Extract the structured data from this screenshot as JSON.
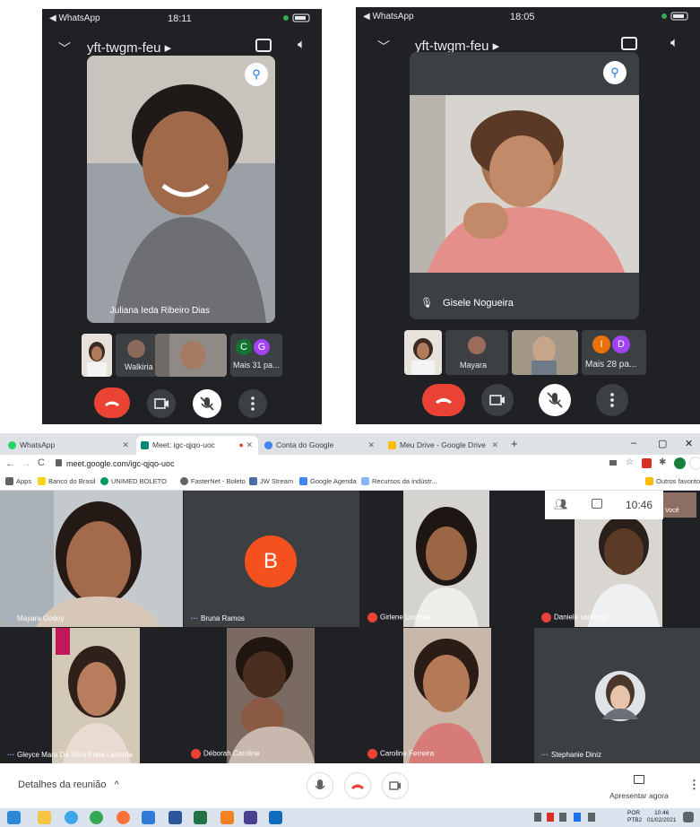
{
  "phone_left": {
    "status": {
      "carrier": "◀ WhatsApp",
      "time": "18:11"
    },
    "meeting_code": "yft-twgm-feu ▸",
    "main_tile_name": "Juliana Ieda Ribeiro Dias",
    "thumbs": [
      {
        "label": ""
      },
      {
        "label": "Walkiria"
      },
      {
        "label": ""
      },
      {
        "label": "Mais 31 pa..."
      }
    ],
    "more_avatars": [
      {
        "letter": "C",
        "color": "#137333"
      },
      {
        "letter": "G",
        "color": "#a142f4"
      }
    ]
  },
  "phone_right": {
    "status": {
      "carrier": "◀ WhatsApp",
      "time": "18:05"
    },
    "meeting_code": "yft-twgm-feu ▸",
    "main_tile_name": "Gisele Nogueira",
    "thumbs": [
      {
        "label": ""
      },
      {
        "label": "Mayara"
      },
      {
        "label": ""
      },
      {
        "label": "Mais 28 pa..."
      }
    ],
    "more_avatars": [
      {
        "letter": "I",
        "color": "#e8710a"
      },
      {
        "letter": "D",
        "color": "#a142f4"
      }
    ]
  },
  "browser": {
    "tabs": [
      {
        "label": "WhatsApp",
        "color": "#25d366",
        "active": false
      },
      {
        "label": "Meet: igc-qjqo-uoc",
        "color": "#00897b",
        "active": true
      },
      {
        "label": "Conta do Google",
        "color": "#4285f4",
        "active": false
      },
      {
        "label": "Meu Drive - Google Drive",
        "color": "#fbbc04",
        "active": false
      }
    ],
    "new_tab": "+",
    "window_controls": [
      "–",
      "▢",
      "✕"
    ],
    "url": "meet.google.com/igc-qjqo-uoc",
    "bookmarks": [
      {
        "label": "Apps",
        "color": "#5f6368"
      },
      {
        "label": "Banco do Brasil",
        "color": "#fcd116"
      },
      {
        "label": "UNIMED BOLETO",
        "color": "#00995d"
      },
      {
        "label": "FasterNet - Boleto",
        "color": "#5f6368"
      },
      {
        "label": "JW Stream",
        "color": "#4a6da7"
      },
      {
        "label": "Google Agenda",
        "color": "#4285f4"
      },
      {
        "label": "Recursos da indústr...",
        "color": "#8ab4f8"
      }
    ],
    "other_bookmarks": "Outros favoritos",
    "meet": {
      "time": "10:46",
      "self_label": "Você",
      "participants": [
        {
          "name": "Mayara Godoy",
          "muted": false
        },
        {
          "name": "Bruna Ramos",
          "muted": false,
          "avatar_letter": "B"
        },
        {
          "name": "Girlene Lustosa",
          "muted": true
        },
        {
          "name": "Daniele santiago",
          "muted": true
        },
        {
          "name": "Gleyce Mara Da Silva Faria Lacerda",
          "muted": false
        },
        {
          "name": "Déborah Caroline",
          "muted": true
        },
        {
          "name": "Caroline Ferreira",
          "muted": true
        },
        {
          "name": "Stephanie Diniz",
          "muted": false
        }
      ],
      "details_label": "Detalhes da reunião",
      "present_label": "Apresentar agora"
    },
    "taskbar": {
      "lang": "POR",
      "lang2": "PTB2",
      "clock_time": "10:46",
      "clock_date": "01/02/2021"
    }
  }
}
